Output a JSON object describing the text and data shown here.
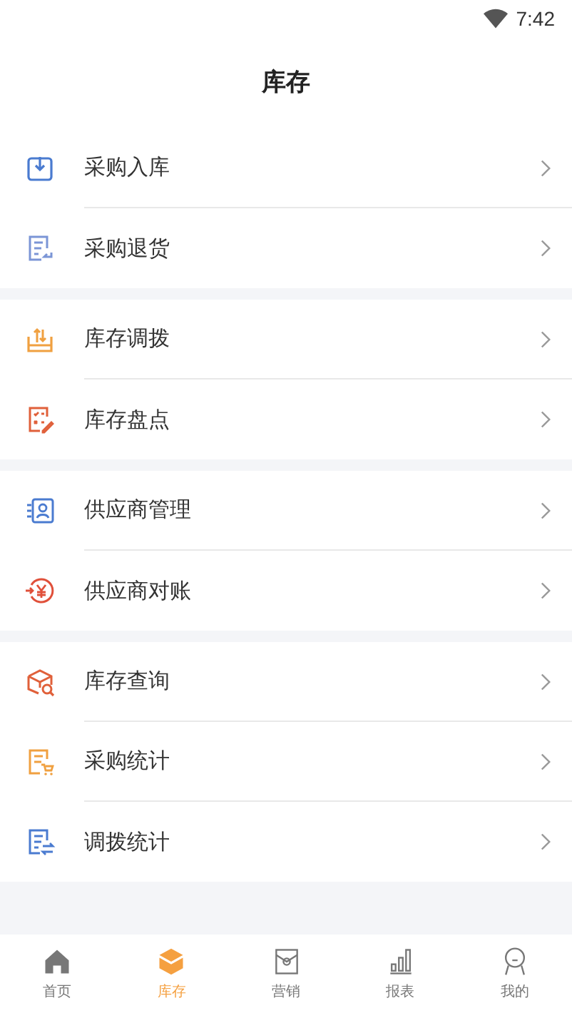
{
  "status_bar": {
    "time": "7:42"
  },
  "title": "库存",
  "sections": [
    {
      "items": [
        {
          "label": "采购入库",
          "color": "#4a7bd0"
        },
        {
          "label": "采购退货",
          "color": "#7b95d6"
        }
      ]
    },
    {
      "items": [
        {
          "label": "库存调拨",
          "color": "#f0a040"
        },
        {
          "label": "库存盘点",
          "color": "#e0603a"
        }
      ]
    },
    {
      "items": [
        {
          "label": "供应商管理",
          "color": "#4a7bd0"
        },
        {
          "label": "供应商对账",
          "color": "#e0503a"
        }
      ]
    },
    {
      "items": [
        {
          "label": "库存查询",
          "color": "#e0603a"
        },
        {
          "label": "采购统计",
          "color": "#f0a040"
        },
        {
          "label": "调拨统计",
          "color": "#4a7bd0"
        }
      ]
    }
  ],
  "tabs": [
    {
      "label": "首页",
      "selected": false
    },
    {
      "label": "库存",
      "selected": true
    },
    {
      "label": "营销",
      "selected": false
    },
    {
      "label": "报表",
      "selected": false
    },
    {
      "label": "我的",
      "selected": false
    }
  ]
}
